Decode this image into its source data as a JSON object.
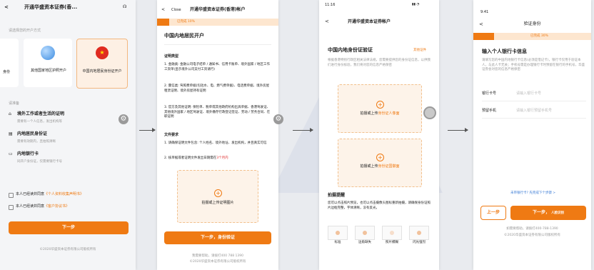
{
  "screen1": {
    "title": "开通华盛资本证券(香...",
    "subtitle": "请选择您的开户方式",
    "card_left_partial": "身份",
    "card_mid": "其他国家地区护照开户",
    "card_right": "中国内地居民身份证开户",
    "section_label": "请准备",
    "req1_title": "境外工作或者生活的证明",
    "req1_desc": "需要有一个人信息，发出机构等",
    "req2_title": "内地居民身份证",
    "req2_desc": "需要有效期内，且拍照清晰",
    "req3_title": "内地银行卡",
    "req3_desc": "同开户身份证，仅需要银行卡号",
    "agree1_prefix": "本人已经读并同意",
    "agree1_link": "《个人资料收集声明书》",
    "agree2_prefix": "本人已经读并同意",
    "agree2_link": "《客户协议书》",
    "next_button": "下一步",
    "footer": "©2020华盛资本证券有限公司版权所有"
  },
  "screen2": {
    "close": "Close",
    "title": "开通华盛资本证券(香港)帐户",
    "progress_text": "已完成 10%",
    "heading": "中国内地居民开户",
    "doc_type": "证明类型",
    "item1": "1. 金融类: 金融公司电子结单 / 通知书、信用卡账单、境外国家 / 地区工作工资单(显示境外公司支付工资请行)",
    "item2": "2. 震信类: 驾照费单据(包括水、电、燃气费单据)、电话费单据、境外房屋租赁证明、境外房屋持有证明",
    "item3": "3. 官方及其他证明: 保险单、税单或其他政府机构出具单据、香港驾驶证、其他境外国家 / 地区驾驶证、境外缴存行政登记签证、劳动 / 劳务合同、在职证明",
    "doc_req": "文件要求",
    "req1": "1. 请确保证明文件包含: 个人姓名、境外地址、发出机构，并且真实可信",
    "req2_prefix": "2. 核单据或者证明文件发出日期需在",
    "req2_highlight": "3个月内",
    "upload_label": "拍摄或上传证明图片",
    "next_button": "下一步，身份验证",
    "help": "我需要帮助，请拨打400 788 1390",
    "footer": "©2020华盛资本证券有限公司版权所有"
  },
  "screen3": {
    "status_time": "11:16",
    "title": "开通华盛资本证券帐户",
    "heading": "中国内地身份证验证",
    "other_cert": "其他证件",
    "desc": "根据香港特别行政区相关法律法规，您需要提供您的身份证信息，以供我们进行身份核验，我们将对您的信息严格保密",
    "front_prefix": "拍摄或上传",
    "front_highlight": "身份证人像面",
    "back_prefix": "拍摄或上传",
    "back_highlight": "身份证国徽面",
    "tip_title": "拍摄提醒",
    "tip_desc": "您可以点击照片预览，也可以点击摄像头图标重新拍摄，请确保身份证照片边框完整，字体清晰，没有反光。",
    "thumbs": [
      "标准",
      "边角缺失",
      "照片模糊",
      "闪光强烈"
    ]
  },
  "screen4": {
    "status_time": "9:41",
    "title": "验证身份",
    "progress_text": "已完成 30%",
    "heading": "输入个人银行卡信息",
    "desc": "请填写您的中国内地银行卡信息(必须是借记卡)，银行卡仅用于验证本人，与此人卡无关；手机号需是办理银行卡时预留在银行的手机号，华盛证券会对您的信息严格保密",
    "card_label": "银行卡号",
    "card_placeholder": "请输入银行卡号",
    "phone_label": "预留手机",
    "phone_placeholder": "请输入银行预留手机号",
    "unsupported": "未带银行卡? 先完成下个步骤 >",
    "prev_button": "上一步",
    "next_button": "下一步，",
    "next_sub": "人脸识别",
    "help": "如需要帮助，请拨打400-788-1390",
    "footer": "©2020华盛资本证券有限公司版权所有"
  },
  "colors": {
    "accent": "#ef7a13",
    "progress_bg": "#fde6cf"
  },
  "icons": [
    "back-arrow-icon",
    "headset-icon",
    "globe-icon",
    "china-flag-icon",
    "gear-icon",
    "plus-icon",
    "id-card-icon",
    "bank-card-icon",
    "checkbox-icon",
    "home-icon"
  ]
}
